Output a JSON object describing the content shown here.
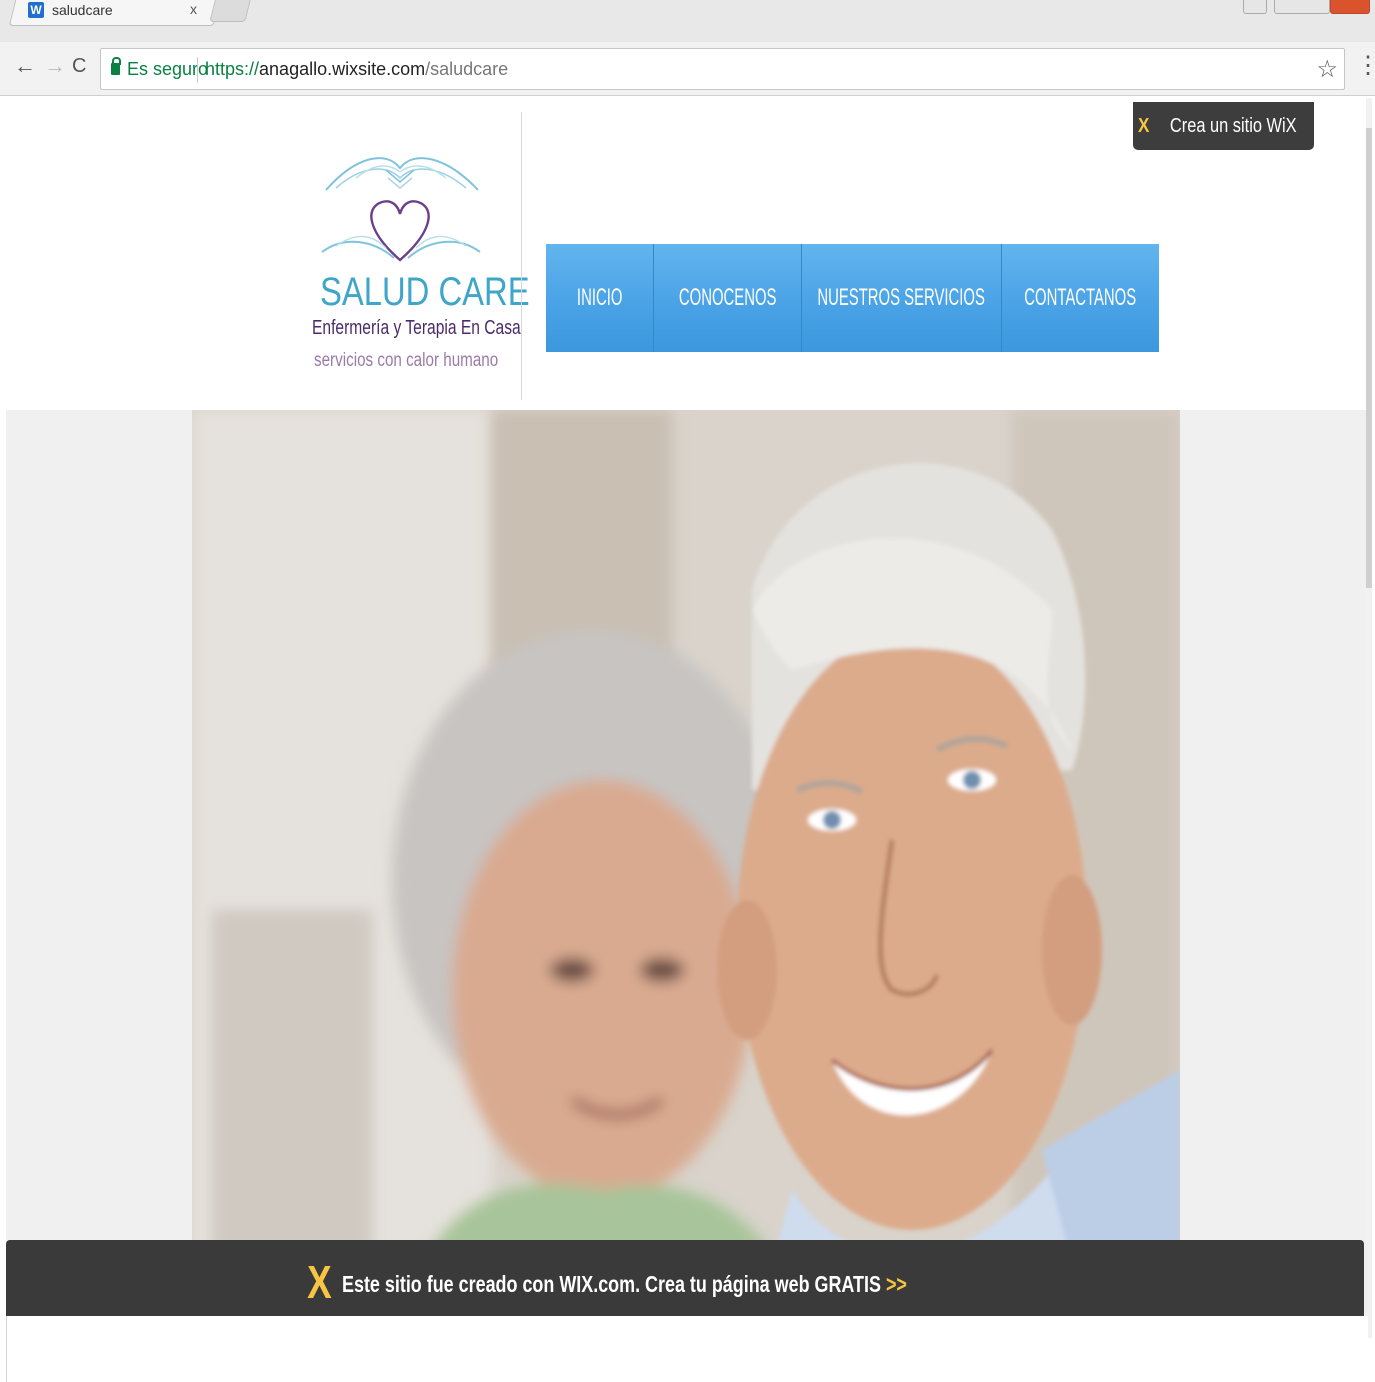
{
  "browser": {
    "tab_title": "saludcare",
    "tab_close": "x",
    "secure_label": "Es seguro",
    "url_scheme": "https://",
    "url_host": "anagallo.wixsite.com",
    "url_path": "/saludcare",
    "nav_back": "←",
    "nav_forward": "→",
    "nav_reload": "C",
    "star": "☆",
    "menu": "⋮"
  },
  "site": {
    "brand_name": "SALUD CARE",
    "brand_subtitle": "Enfermería y Terapia En Casa",
    "brand_tagline": "servicios con calor humano",
    "wix_badge": "Crea un sitio WiX",
    "nav": [
      "INICIO",
      "CONOCENOS",
      "NUESTROS SERVICIOS",
      "CONTACTANOS"
    ]
  },
  "footer": {
    "text": "Este sitio fue creado con WIX.com. Crea tu página web GRATIS",
    "arrow": ">>"
  },
  "colors": {
    "nav_blue": "#4aa3e6",
    "brand_teal": "#3fa6c9",
    "brand_purple": "#4b2a6a",
    "wix_yellow": "#f6c544",
    "wix_dark": "#3a3a3a"
  },
  "icons": {
    "tab_favicon": "wix-favicon-icon",
    "lock": "lock-icon",
    "star": "star-icon",
    "wix": "wix-x-icon"
  }
}
